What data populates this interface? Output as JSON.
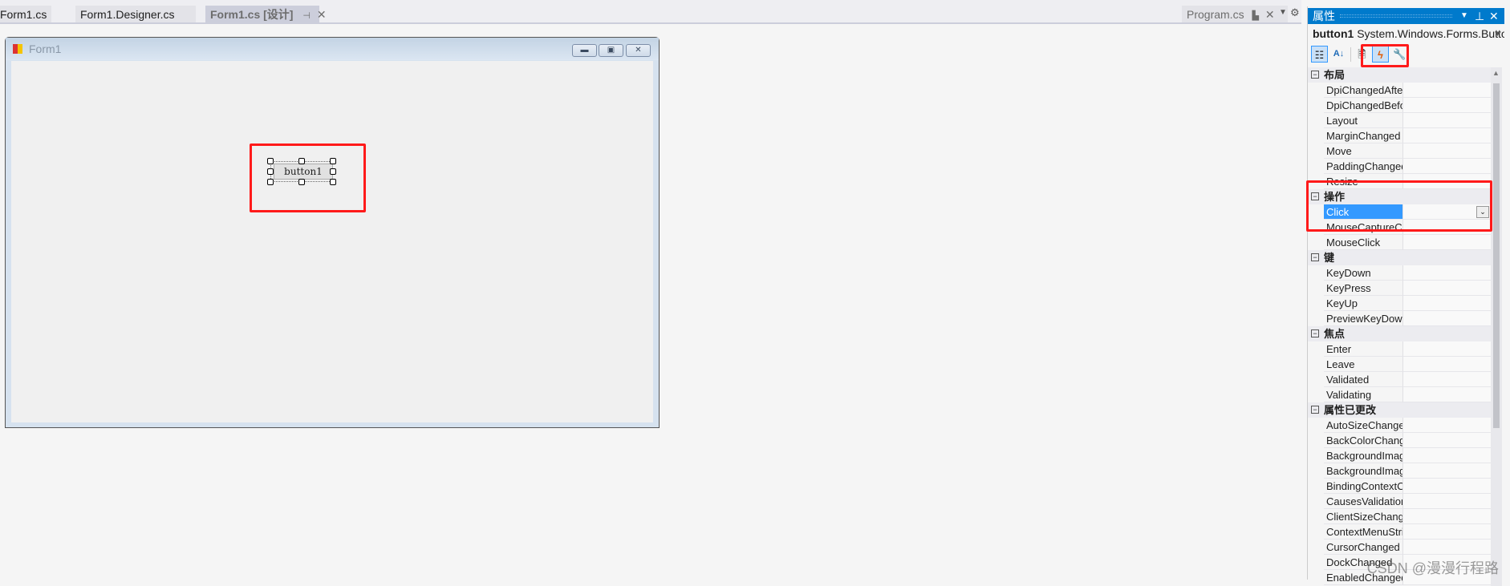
{
  "tabs": [
    {
      "label": "Form1.cs"
    },
    {
      "label": "Form1.Designer.cs"
    },
    {
      "label": "Form1.cs [设计]",
      "active": true
    },
    {
      "label": "Program.cs"
    }
  ],
  "form": {
    "title": "Form1",
    "button_label": "button1",
    "controls": [
      "minimize",
      "maximize",
      "close"
    ]
  },
  "properties": {
    "title": "属性",
    "object_name": "button1",
    "object_type": "System.Windows.Forms.Butto",
    "toolbar": [
      "categorized-icon",
      "alphabetical-icon",
      "property-pages-icon",
      "events-icon",
      "settings-icon"
    ],
    "active_toolbar": "events-icon",
    "selected_event": "Click",
    "categories": [
      {
        "name": "布局",
        "items": [
          "DpiChangedAfte",
          "DpiChangedBefo",
          "Layout",
          "MarginChanged",
          "Move",
          "PaddingChanged",
          "Resize"
        ]
      },
      {
        "name": "操作",
        "items": [
          "Click",
          "MouseCaptureCl",
          "MouseClick"
        ]
      },
      {
        "name": "键",
        "items": [
          "KeyDown",
          "KeyPress",
          "KeyUp",
          "PreviewKeyDown"
        ]
      },
      {
        "name": "焦点",
        "items": [
          "Enter",
          "Leave",
          "Validated",
          "Validating"
        ]
      },
      {
        "name": "属性已更改",
        "items": [
          "AutoSizeChanged",
          "BackColorChang",
          "BackgroundImag",
          "BackgroundImag",
          "BindingContextC",
          "CausesValidation",
          "ClientSizeChange",
          "ContextMenuStri",
          "CursorChanged",
          "DockChanged",
          "EnabledChanged"
        ]
      }
    ]
  },
  "watermark": "CSDN @漫漫行程路",
  "colors": {
    "accent": "#007acc",
    "selection": "#3399ff",
    "highlight_box": "#ff1a1a"
  }
}
